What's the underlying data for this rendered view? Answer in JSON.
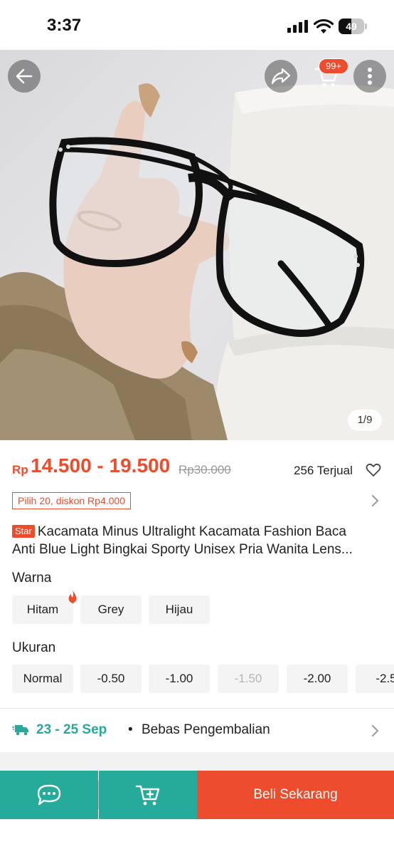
{
  "status_bar": {
    "time": "3:37",
    "battery": "49",
    "battery_level_pct": 49
  },
  "hero": {
    "page_indicator": "1/9",
    "cart_badge": "99+",
    "icons": [
      "back-arrow-icon",
      "share-icon",
      "cart-icon",
      "more-vertical-icon"
    ]
  },
  "price": {
    "currency": "Rp",
    "range": "14.500 - 19.500",
    "original": "Rp30.000",
    "sold": "256 Terjual"
  },
  "promo": {
    "tag": "Pilih 20, diskon Rp4.000"
  },
  "product": {
    "badge": "Star",
    "title_line1": "Kacamata Minus Ultralight Kacamata Fashion Baca",
    "title_line2": "Anti Blue Light Bingkai Sporty Unisex Pria Wanita Lens..."
  },
  "variants": {
    "color_label": "Warna",
    "colors": [
      "Hitam",
      "Grey",
      "Hijau"
    ],
    "size_label": "Ukuran",
    "sizes": [
      "Normal",
      "-0.50",
      "-1.00",
      "-1.50",
      "-2.00",
      "-2.5"
    ],
    "disabled_sizes": [
      "-1.50"
    ]
  },
  "shipping": {
    "date": "23 - 25 Sep",
    "separator": "•",
    "return_text": "Bebas Pengembalian"
  },
  "bottom_bar": {
    "buy_label": "Beli Sekarang"
  },
  "colors": {
    "accent": "#ee4d2d",
    "teal": "#26aa99"
  }
}
